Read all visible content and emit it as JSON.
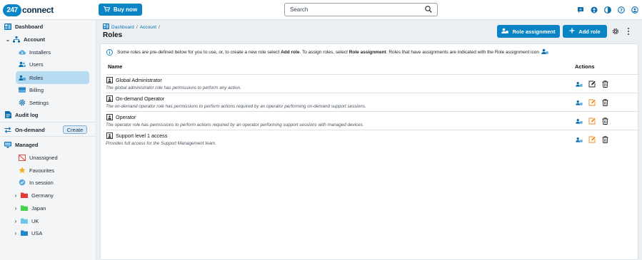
{
  "app": {
    "logo_number": "247",
    "logo_text": "connect",
    "buy_label": "Buy now",
    "search_placeholder": "Search"
  },
  "sidebar": {
    "dashboard": "Dashboard",
    "account": "Account",
    "installers": "Installers",
    "users": "Users",
    "roles": "Roles",
    "billing": "Billing",
    "settings": "Settings",
    "audit_log": "Audit log",
    "on_demand": "On-demand",
    "create_label": "Create",
    "managed": "Managed",
    "unassigned": "Unassigned",
    "favourites": "Favourites",
    "in_session": "In session",
    "groups": [
      {
        "label": "Germany",
        "color": "#e53935"
      },
      {
        "label": "Japan",
        "color": "#43d34a"
      },
      {
        "label": "UK",
        "color": "#6ec6ea"
      },
      {
        "label": "USA",
        "color": "#1e88c9"
      }
    ]
  },
  "breadcrumb": {
    "dashboard": "Dashboard",
    "sep1": "/",
    "account": "Account",
    "sep2": "/"
  },
  "page": {
    "title": "Roles",
    "role_assignment_label": "Role assignment",
    "add_role_label": "Add role"
  },
  "info": {
    "text1": "Some roles are pre-defined below for you to use, or, to create a new role select ",
    "add_role": "Add role",
    "text2": ". To assign roles, select ",
    "role_assignment": "Role assignment",
    "text3": ". Roles that have assignments are indicated with the Role assignment icon"
  },
  "table": {
    "col_name": "Name",
    "col_actions": "Actions",
    "rows": [
      {
        "name": "Global Administrator",
        "description": "The global administrator role has permissions to perform any action."
      },
      {
        "name": "On-demand Operator",
        "description": "The on-demand operator role has permissions to perform actions required by an operator performing on-demand support sessions."
      },
      {
        "name": "Operator",
        "description": "The operator role has permissions to perform actions required by an operator performing support sessions with managed devices."
      },
      {
        "name": "Support level 1 access",
        "description": "Provides full access for the Support Management team."
      }
    ]
  },
  "colors": {
    "primary": "#0b84c6",
    "active_nav": "#b7dcf2",
    "edit_orange": "#f08a1c"
  }
}
